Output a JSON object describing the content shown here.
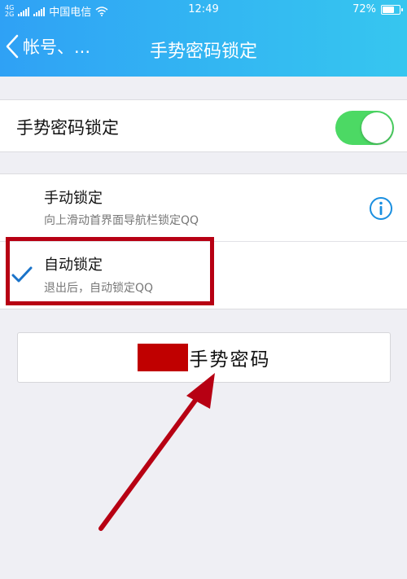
{
  "status_bar": {
    "signal_top": "4G",
    "signal_bottom": "2G",
    "carrier": "中国电信",
    "wifi_icon": "wifi-icon",
    "time": "12:49",
    "battery_percent": "72%",
    "battery_level": 0.72
  },
  "nav": {
    "back_label": "帐号、...",
    "title": "手势密码锁定"
  },
  "gesture_lock": {
    "label": "手势密码锁定",
    "enabled": true
  },
  "options": [
    {
      "title": "手动锁定",
      "subtitle": "向上滑动首界面导航栏锁定QQ",
      "icon": "info-icon",
      "selected": false
    },
    {
      "title": "自动锁定",
      "subtitle": "退出后，自动锁定QQ",
      "icon": "checkmark-icon",
      "selected": true
    }
  ],
  "action": {
    "label": "手势密码"
  },
  "colors": {
    "header_start": "#2fa1f5",
    "header_end": "#36c6ef",
    "toggle_on": "#4cd964",
    "accent": "#1a73c9",
    "annotation": "#b70013"
  }
}
